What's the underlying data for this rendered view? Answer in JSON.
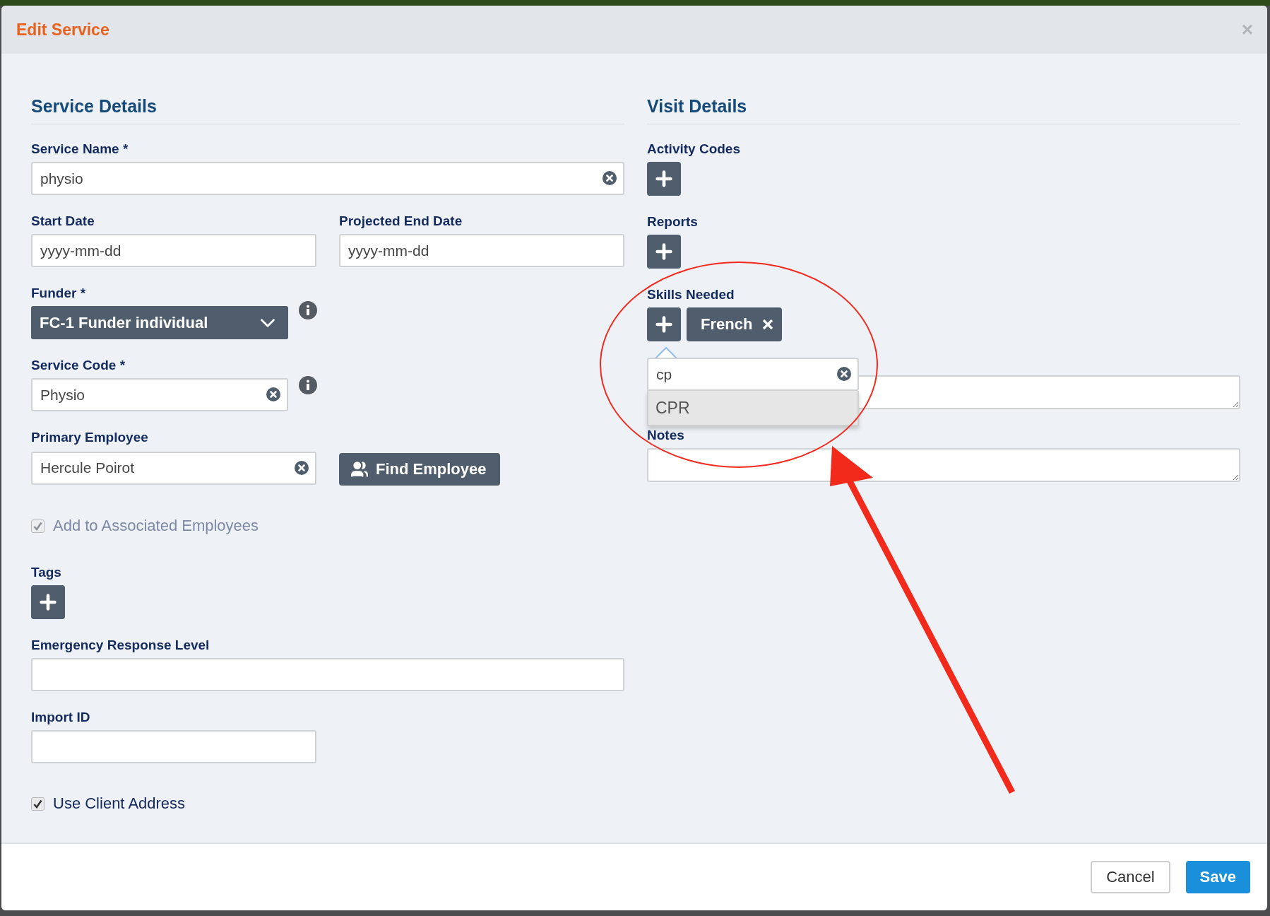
{
  "dialog": {
    "title": "Edit Service",
    "close": "×"
  },
  "service_details": {
    "heading": "Service Details",
    "service_name": {
      "label": "Service Name *",
      "value": "physio"
    },
    "start_date": {
      "label": "Start Date",
      "placeholder": "yyyy-mm-dd"
    },
    "end_date": {
      "label": "Projected End Date",
      "placeholder": "yyyy-mm-dd"
    },
    "funder": {
      "label": "Funder *",
      "value": "FC-1 Funder individual"
    },
    "service_code": {
      "label": "Service Code *",
      "value": "Physio"
    },
    "primary_employee": {
      "label": "Primary Employee",
      "value": "Hercule Poirot",
      "button": "Find Employee"
    },
    "add_to_associated": {
      "label": "Add to Associated Employees",
      "checked": true,
      "disabled": true
    },
    "tags": {
      "label": "Tags"
    },
    "emergency_response_level": {
      "label": "Emergency Response Level"
    },
    "import_id": {
      "label": "Import ID"
    },
    "use_client_address": {
      "label": "Use Client Address",
      "checked": true,
      "disabled": false
    }
  },
  "visit_details": {
    "heading": "Visit Details",
    "activity_codes": {
      "label": "Activity Codes"
    },
    "reports": {
      "label": "Reports"
    },
    "skills_needed": {
      "label": "Skills Needed",
      "tags": [
        "French"
      ],
      "search": {
        "value": "cp"
      },
      "suggestions": [
        {
          "label": "CPR",
          "selected": true
        }
      ]
    },
    "notes": {
      "label": "Notes"
    }
  },
  "footer": {
    "buttons": [
      {
        "label": "Cancel",
        "kind": "default"
      },
      {
        "label": "Save",
        "kind": "primary"
      }
    ]
  }
}
